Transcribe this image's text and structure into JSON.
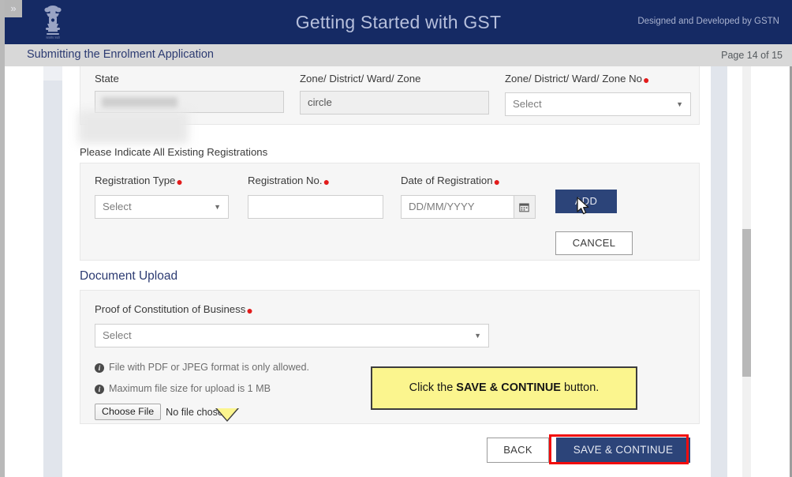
{
  "window": {
    "collapse_icon": "chevron-double-right-icon",
    "emblem_name": "india-national-emblem"
  },
  "header": {
    "title": "Getting Started with GST",
    "credit": "Designed and Developed by GSTN",
    "subtitle": "Submitting the Enrolment Application",
    "page_indicator": "Page 14 of 15",
    "bar_color": "#152a64",
    "subbar_color": "#d8d8d8"
  },
  "address_section": {
    "fields": [
      {
        "label": "State",
        "required": false,
        "value": "",
        "redacted": true,
        "type": "text-readonly"
      },
      {
        "label": "Zone/ District/ Ward/ Zone",
        "required": false,
        "value": "circle",
        "type": "text-readonly"
      },
      {
        "label": "Zone/ District/ Ward/ Zone No",
        "required": true,
        "value": "Select",
        "type": "select"
      }
    ]
  },
  "registrations_section": {
    "heading": "Please Indicate All Existing Registrations",
    "fields": [
      {
        "label": "Registration Type",
        "required": true,
        "value": "Select",
        "type": "select"
      },
      {
        "label": "Registration No.",
        "required": true,
        "value": "",
        "placeholder": "",
        "type": "text"
      },
      {
        "label": "Date of Registration",
        "required": true,
        "value": "",
        "placeholder": "DD/MM/YYYY",
        "type": "date",
        "icon": "calendar-icon"
      }
    ],
    "add_label": "ADD",
    "cancel_label": "CANCEL"
  },
  "document_upload": {
    "title": "Document Upload",
    "field": {
      "label": "Proof of Constitution of Business",
      "required": true,
      "value": "Select",
      "type": "select"
    },
    "hints": [
      "File with PDF or JPEG format is only allowed.",
      "Maximum file size for upload is 1 MB"
    ],
    "file_input": {
      "button_label": "Choose File",
      "status_text": "No file chosen"
    }
  },
  "footer": {
    "back_label": "BACK",
    "save_continue_label": "SAVE & CONTINUE",
    "highlight_color": "#f20c0c"
  },
  "callout": {
    "prefix": "Click the ",
    "emphasis": "SAVE & CONTINUE",
    "suffix": " button.",
    "background": "#fbf58e",
    "border": "#3d3d3d"
  },
  "scrollbar": {
    "orientation": "vertical",
    "thumb_position_pct": 40
  },
  "colors": {
    "primary_blue": "#2c4479",
    "header_navy": "#152a64",
    "required_red": "#e21b1b",
    "panel_gray": "#f6f6f6"
  }
}
